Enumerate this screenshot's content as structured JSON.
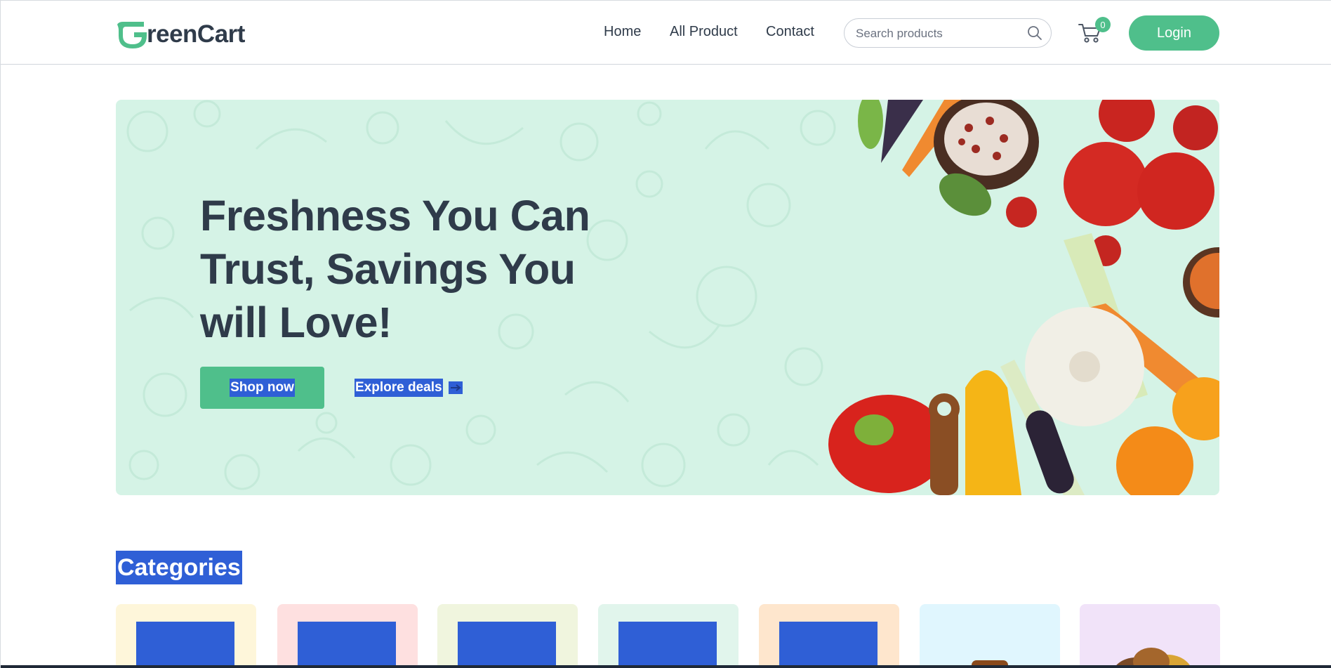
{
  "brand": {
    "name_rest": "reenCart",
    "accent": "#4fbf8b",
    "text_color": "#2f3b4a"
  },
  "nav": {
    "links": [
      "Home",
      "All Product",
      "Contact"
    ],
    "search_placeholder": "Search products",
    "cart_count": "0",
    "login_label": "Login"
  },
  "hero": {
    "title_lines": [
      "Freshness You Can",
      "Trust, Savings You",
      "will Love!"
    ],
    "shop_label": "Shop now",
    "explore_label": "Explore deals",
    "background": "#d5f3e6"
  },
  "categories": {
    "title": "Categories",
    "cards": [
      {
        "bg": "#fef6da",
        "icon": "grapes-image",
        "selected": true
      },
      {
        "bg": "#fee0e0",
        "icon": "fruits-image",
        "selected": true
      },
      {
        "bg": "#f0f5de",
        "icon": "drinks-image",
        "selected": true
      },
      {
        "bg": "#e1f5ec",
        "icon": "instant-food-image",
        "selected": true
      },
      {
        "bg": "#fee6cd",
        "icon": "dairy-image",
        "selected": true
      },
      {
        "bg": "#e0f6fe",
        "icon": "bakery-image",
        "selected": false
      },
      {
        "bg": "#f1e3f9",
        "icon": "grains-image",
        "selected": false
      }
    ]
  },
  "selection_color": "#2f5fd6"
}
